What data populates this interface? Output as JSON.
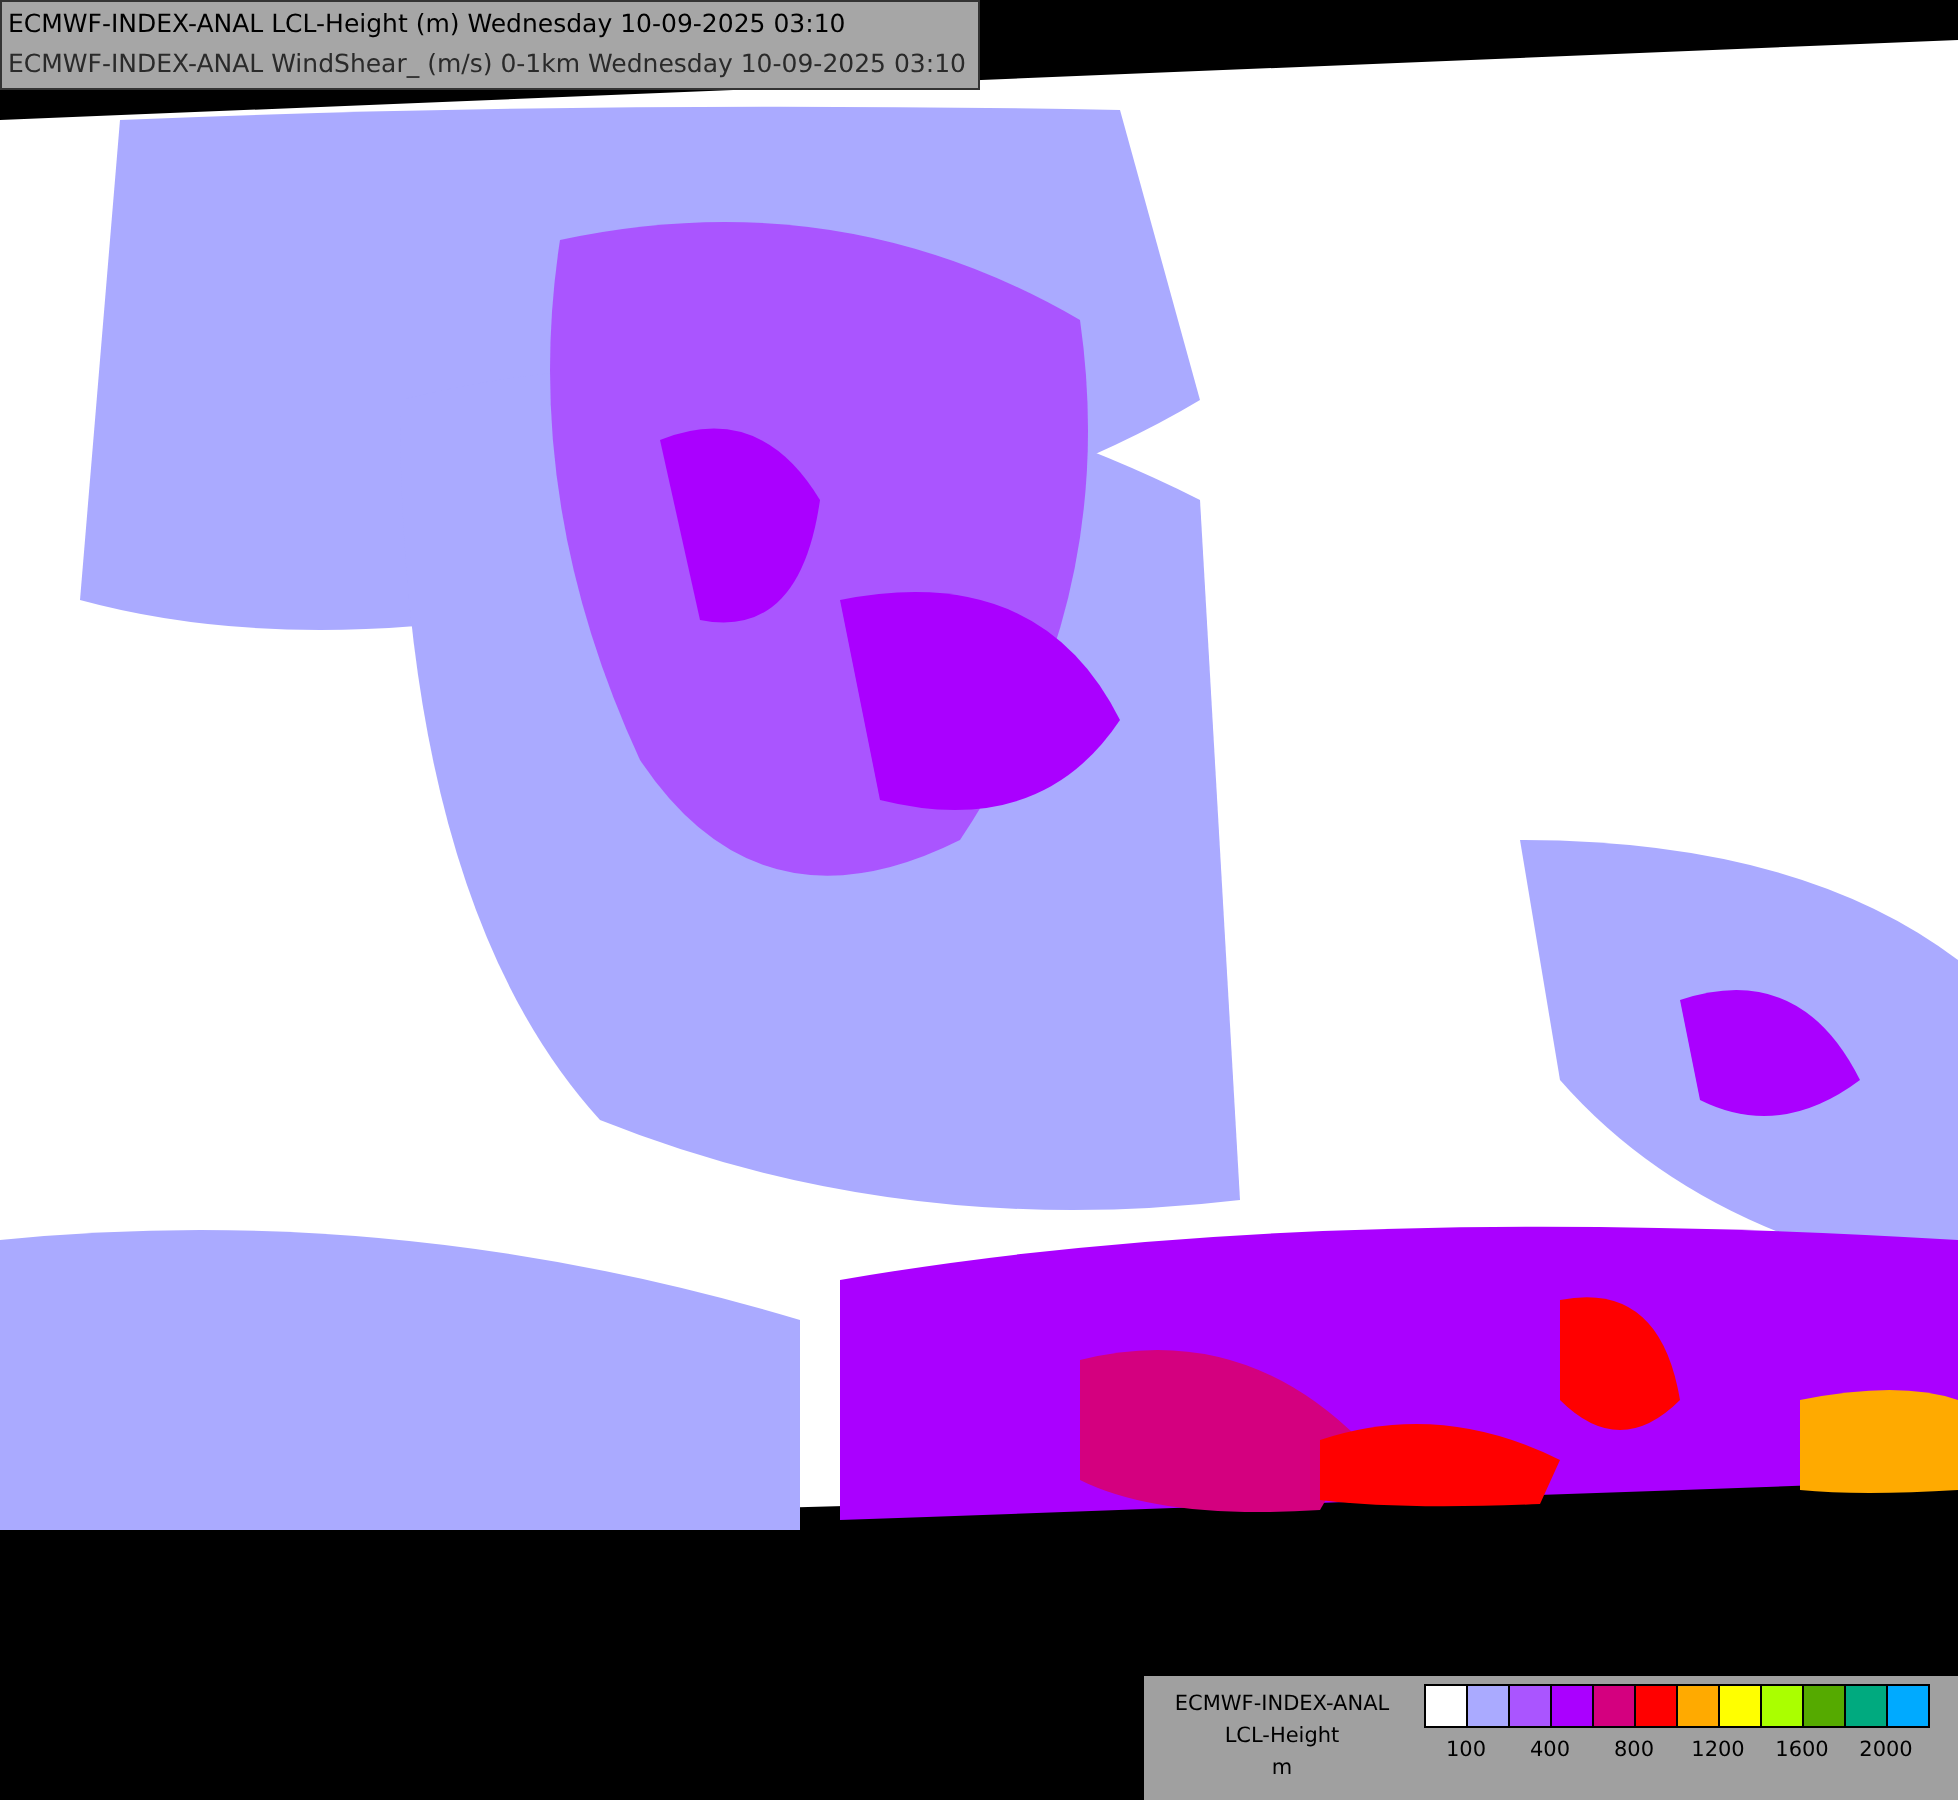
{
  "header": {
    "lines": [
      "ECMWF-INDEX-ANAL LCL-Height (m) Wednesday 10-09-2025 03:10",
      "ECMWF-INDEX-ANAL WindShear_ (m/s) 0-1km Wednesday 10-09-2025 03:10"
    ]
  },
  "legend": {
    "title_lines": [
      "ECMWF-INDEX-ANAL",
      "LCL-Height",
      "m"
    ],
    "swatches": [
      {
        "color": "#ffffff"
      },
      {
        "color": "#aaaaff"
      },
      {
        "color": "#aa55ff"
      },
      {
        "color": "#aa00ff"
      },
      {
        "color": "#d4007f"
      },
      {
        "color": "#ff0000"
      },
      {
        "color": "#ffaa00"
      },
      {
        "color": "#ffff00"
      },
      {
        "color": "#aaff00"
      },
      {
        "color": "#55aa00"
      },
      {
        "color": "#00aa7f"
      },
      {
        "color": "#00aaff"
      }
    ],
    "tick_labels": [
      "100",
      "400",
      "800",
      "1200",
      "1600",
      "2000"
    ]
  }
}
